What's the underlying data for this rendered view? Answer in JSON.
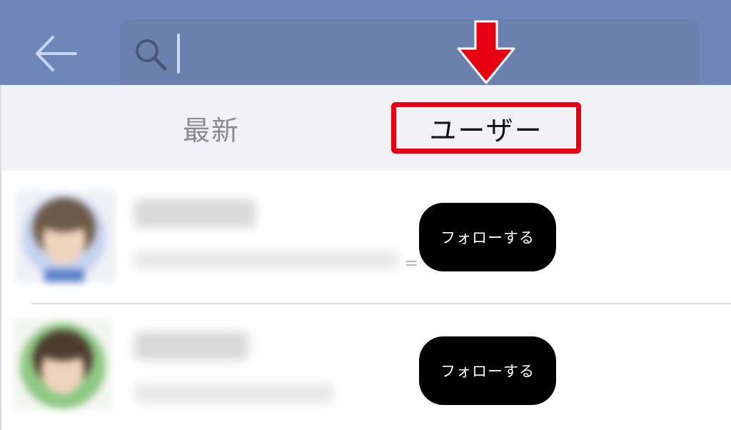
{
  "header": {
    "back_icon": "arrow-left-icon",
    "search": {
      "icon": "search-icon",
      "value": "",
      "placeholder": ""
    },
    "colors": {
      "header_bg": "#6e86b9",
      "search_bg": "#6c80ae"
    }
  },
  "annotation": {
    "arrow_icon": "down-arrow-icon",
    "color": "#e60012"
  },
  "tabs": [
    {
      "label": "最新",
      "active": false
    },
    {
      "label": "ユーザー",
      "active": true
    }
  ],
  "users": [
    {
      "avatar": "avatar-blurred",
      "name": "",
      "description": "",
      "follow_label": "フォローする"
    },
    {
      "avatar": "avatar-blurred",
      "name": "",
      "description": "",
      "follow_label": "フォローする"
    }
  ],
  "row_marker": "="
}
